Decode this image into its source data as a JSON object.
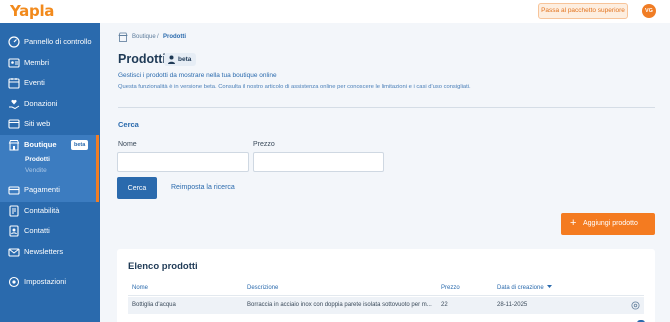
{
  "header": {
    "logo": "Yapla",
    "upgrade_label": "Passa al pacchetto superiore",
    "avatar_initials": "VG"
  },
  "sidebar": {
    "items": [
      {
        "label": "Pannello di controllo",
        "icon": "gauge-icon"
      },
      {
        "label": "Membri",
        "icon": "members-icon"
      },
      {
        "label": "Eventi",
        "icon": "calendar-icon"
      },
      {
        "label": "Donazioni",
        "icon": "donation-icon"
      },
      {
        "label": "Siti web",
        "icon": "website-icon"
      },
      {
        "label": "Boutique",
        "icon": "shop-icon",
        "badge": "beta"
      },
      {
        "label": "Pagamenti",
        "icon": "payments-icon"
      },
      {
        "label": "Contabilità",
        "icon": "accounting-icon"
      },
      {
        "label": "Contatti",
        "icon": "contacts-icon"
      },
      {
        "label": "Newsletters",
        "icon": "newsletter-icon"
      },
      {
        "label": "Impostazioni",
        "icon": "gear-icon"
      }
    ],
    "boutique_sub": [
      "Prodotti",
      "Vendite"
    ]
  },
  "breadcrumb": {
    "parent": "Boutique",
    "separator": "/",
    "current": "Prodotti"
  },
  "page": {
    "title": "Prodotti",
    "badge": "beta",
    "description": "Gestisci i prodotti da mostrare nella tua boutique online",
    "note": "Questa funzionalità è in versione beta. Consulta il nostro articolo di assistenza online per conoscere le limitazioni e i casi d'uso consigliati."
  },
  "search": {
    "title": "Cerca",
    "name_label": "Nome",
    "name_value": "",
    "price_label": "Prezzo",
    "price_value": "",
    "submit_label": "Cerca",
    "reset_label": "Reimposta la ricerca"
  },
  "add_button_label": "Aggiungi prodotto",
  "products": {
    "title": "Elenco prodotti",
    "columns": [
      "Nome",
      "Descrizione",
      "Prezzo",
      "Data di creazione"
    ],
    "sort_column": "Data di creazione",
    "rows": [
      {
        "name": "Bottiglia d'acqua",
        "description": "Borraccia in acciaio inox con doppia parete isolata sottovuoto per m...",
        "price": "22",
        "created": "28-11-2025"
      }
    ]
  },
  "colors": {
    "primary": "#2a6aad",
    "accent": "#f47b20",
    "sidebar": "#2a6aad"
  }
}
